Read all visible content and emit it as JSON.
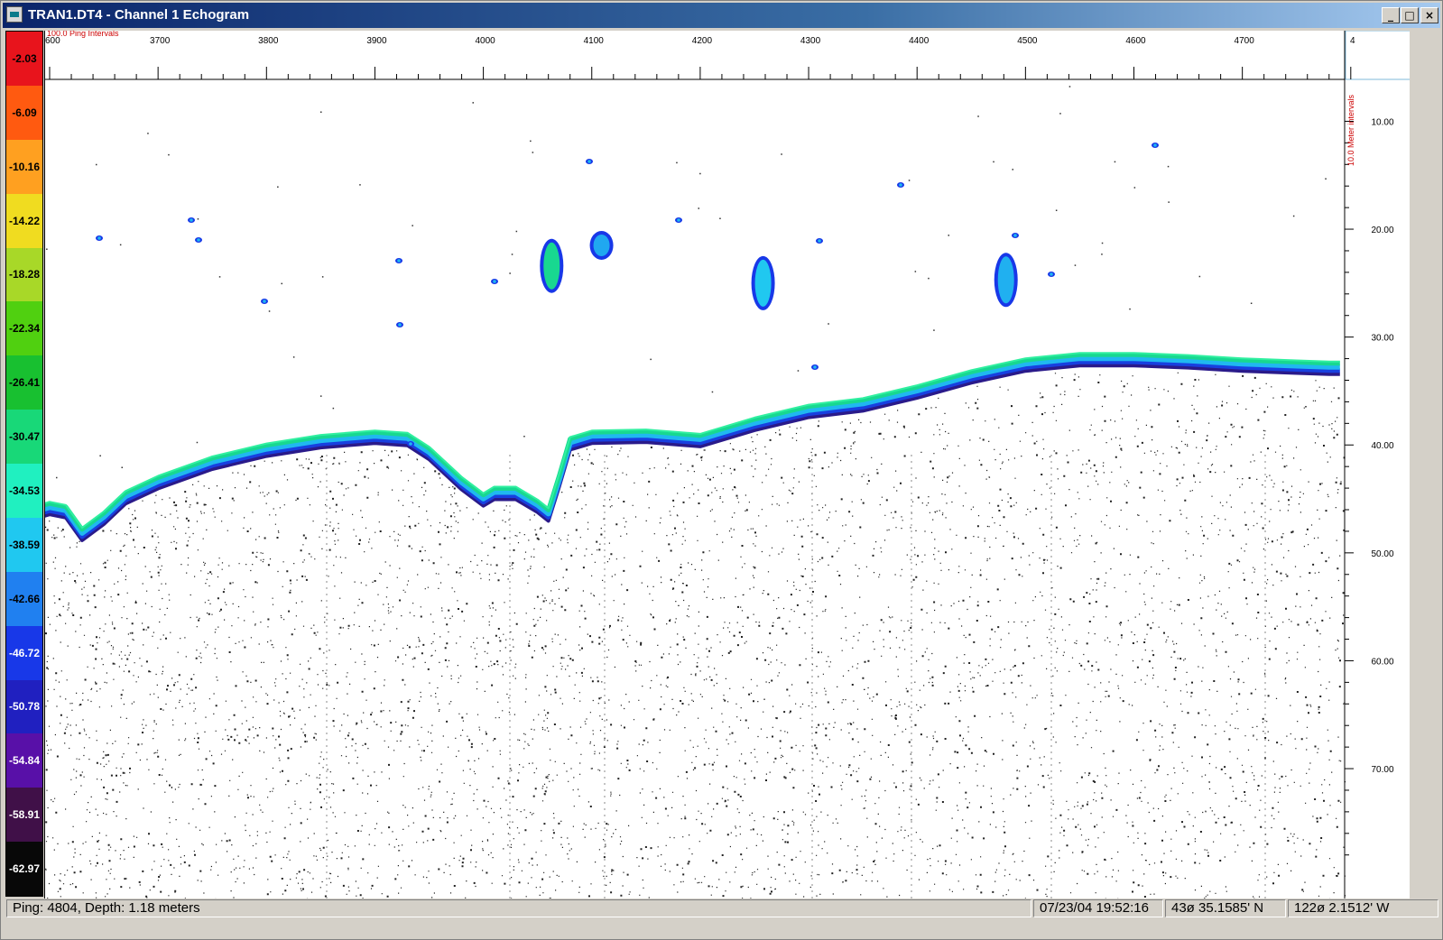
{
  "window": {
    "title": "TRAN1.DT4 - Channel 1  Echogram",
    "icon": "echogram-app-icon",
    "controls": {
      "minimize": "_",
      "maximize": "□",
      "close": "×"
    }
  },
  "color_scale": {
    "labels": [
      "-2.03",
      "-6.09",
      "-10.16",
      "-14.22",
      "-18.28",
      "-22.34",
      "-26.41",
      "-30.47",
      "-34.53",
      "-38.59",
      "-42.66",
      "-46.72",
      "-50.78",
      "-54.84",
      "-58.91",
      "-62.97"
    ],
    "colors": [
      "#e8141c",
      "#ff5a10",
      "#ffa020",
      "#f0dc20",
      "#a8d828",
      "#50d010",
      "#18c030",
      "#18d878",
      "#20f0c0",
      "#20c8f0",
      "#2080f0",
      "#1838e8",
      "#2020c0",
      "#5810a8",
      "#401048",
      "#080808"
    ],
    "label_colors": [
      "#000000",
      "#000000",
      "#000000",
      "#000000",
      "#000000",
      "#000000",
      "#000000",
      "#000000",
      "#000000",
      "#000000",
      "#000000",
      "#ffffff",
      "#ffffff",
      "#ffffff",
      "#ffffff",
      "#ffffff"
    ]
  },
  "top_axis": {
    "interval_label": "100.0 Ping Intervals",
    "tick_labels": [
      "600",
      "3700",
      "3800",
      "3900",
      "4000",
      "4100",
      "4200",
      "4300",
      "4400",
      "4500",
      "4600",
      "4700",
      "4"
    ]
  },
  "right_axis": {
    "interval_label": "10.0 Meter intervals",
    "tick_labels": [
      "10.00",
      "20.00",
      "30.00",
      "40.00",
      "50.00",
      "60.00",
      "70.00"
    ]
  },
  "status": {
    "ping_depth": "Ping: 4804, Depth: 1.18 meters",
    "datetime": "07/23/04 19:52:16",
    "latitude": "43ø 35.1585' N",
    "longitude": "122ø 2.1512' W"
  },
  "echogram": {
    "bottom_profile_pings": [
      3560,
      3575,
      3590,
      3600,
      3615,
      3630,
      3650,
      3670,
      3700,
      3750,
      3800,
      3850,
      3900,
      3930,
      3950,
      3980,
      4000,
      4010,
      4030,
      4050,
      4060,
      4070,
      4080,
      4100,
      4150,
      4200,
      4250,
      4300,
      4350,
      4400,
      4450,
      4500,
      4550,
      4600,
      4650,
      4700,
      4750,
      4780,
      4790
    ],
    "bottom_profile_depths": [
      45.5,
      45.8,
      45.9,
      45.6,
      45.9,
      48.0,
      46.5,
      44.6,
      43.2,
      41.4,
      40.2,
      39.4,
      39.0,
      39.2,
      40.5,
      43.3,
      44.8,
      44.2,
      44.2,
      45.4,
      46.2,
      43.0,
      39.6,
      39.0,
      38.9,
      39.3,
      37.8,
      36.6,
      36.0,
      34.8,
      33.4,
      32.3,
      31.8,
      31.8,
      32.0,
      32.3,
      32.5,
      32.6,
      32.6
    ],
    "fish_schools": [
      {
        "ping": 4063,
        "depth": 23.4,
        "color": "#18d890"
      },
      {
        "ping": 4258,
        "depth": 25.0,
        "color": "#20c8f0"
      },
      {
        "ping": 4482,
        "depth": 24.7,
        "color": "#20b0f0"
      },
      {
        "ping": 4109,
        "depth": 21.5,
        "color": "#20a8f0"
      }
    ]
  }
}
